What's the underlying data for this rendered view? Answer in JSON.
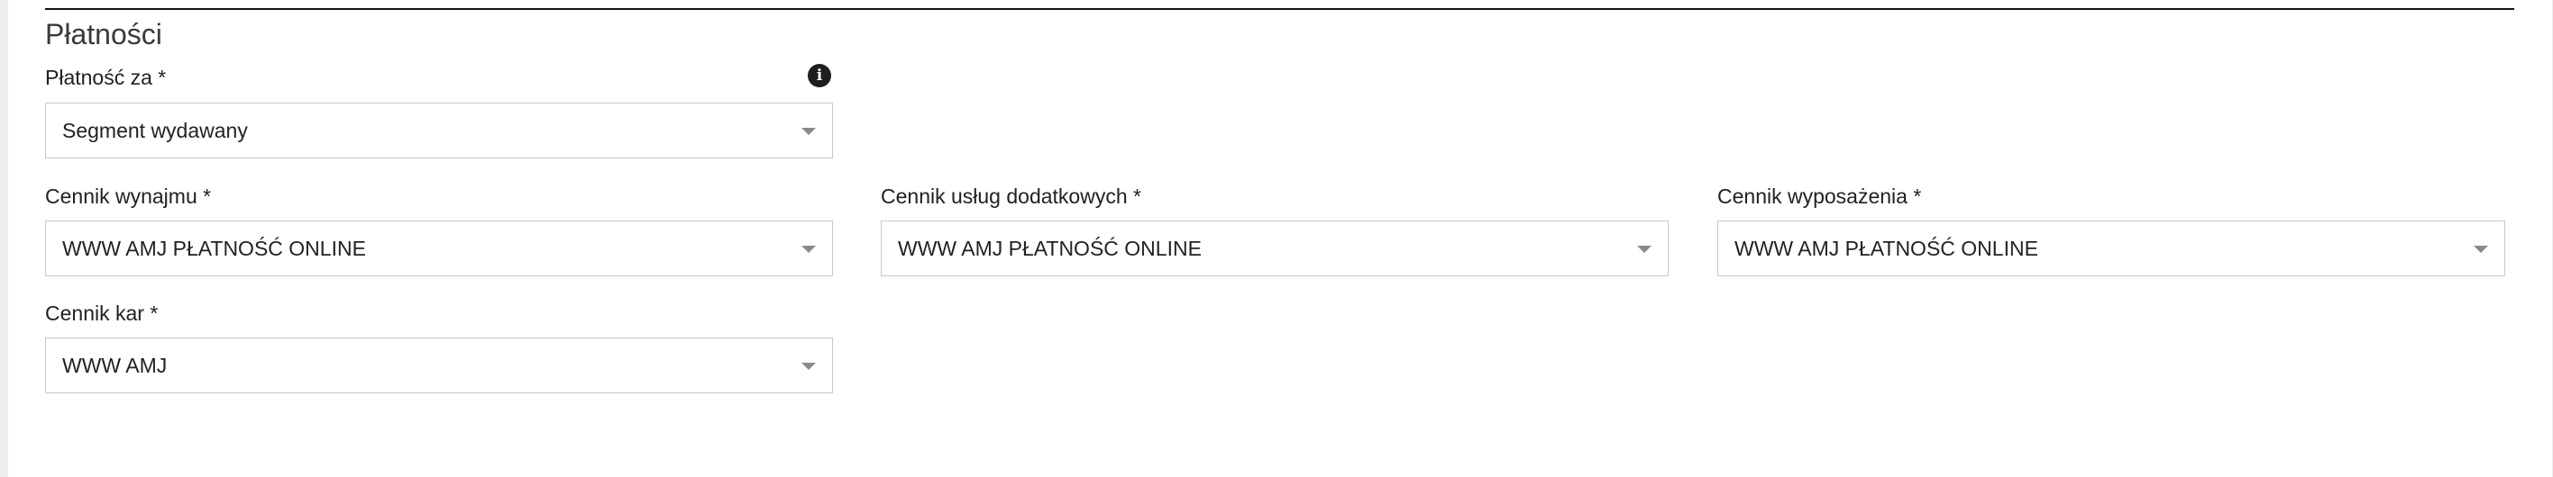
{
  "section": {
    "title": "Płatności"
  },
  "fields": {
    "payment_for": {
      "label": "Płatność za *",
      "value": "Segment wydawany",
      "info_icon": "info-icon"
    },
    "rental_pricelist": {
      "label": "Cennik wynajmu *",
      "value": "WWW AMJ PŁATNOŚĆ ONLINE"
    },
    "additional_services_pricelist": {
      "label": "Cennik usług dodatkowych *",
      "value": "WWW AMJ PŁATNOŚĆ ONLINE"
    },
    "equipment_pricelist": {
      "label": "Cennik wyposażenia *",
      "value": "WWW AMJ PŁATNOŚĆ ONLINE"
    },
    "penalties_pricelist": {
      "label": "Cennik kar *",
      "value": "WWW AMJ"
    }
  },
  "icons": {
    "info_glyph": "i",
    "dropdown": "chevron-down-icon"
  },
  "colors": {
    "border": "#c8c8c8",
    "caret": "#8a8a8a",
    "info_icon_bg": "#1e1e1e"
  }
}
